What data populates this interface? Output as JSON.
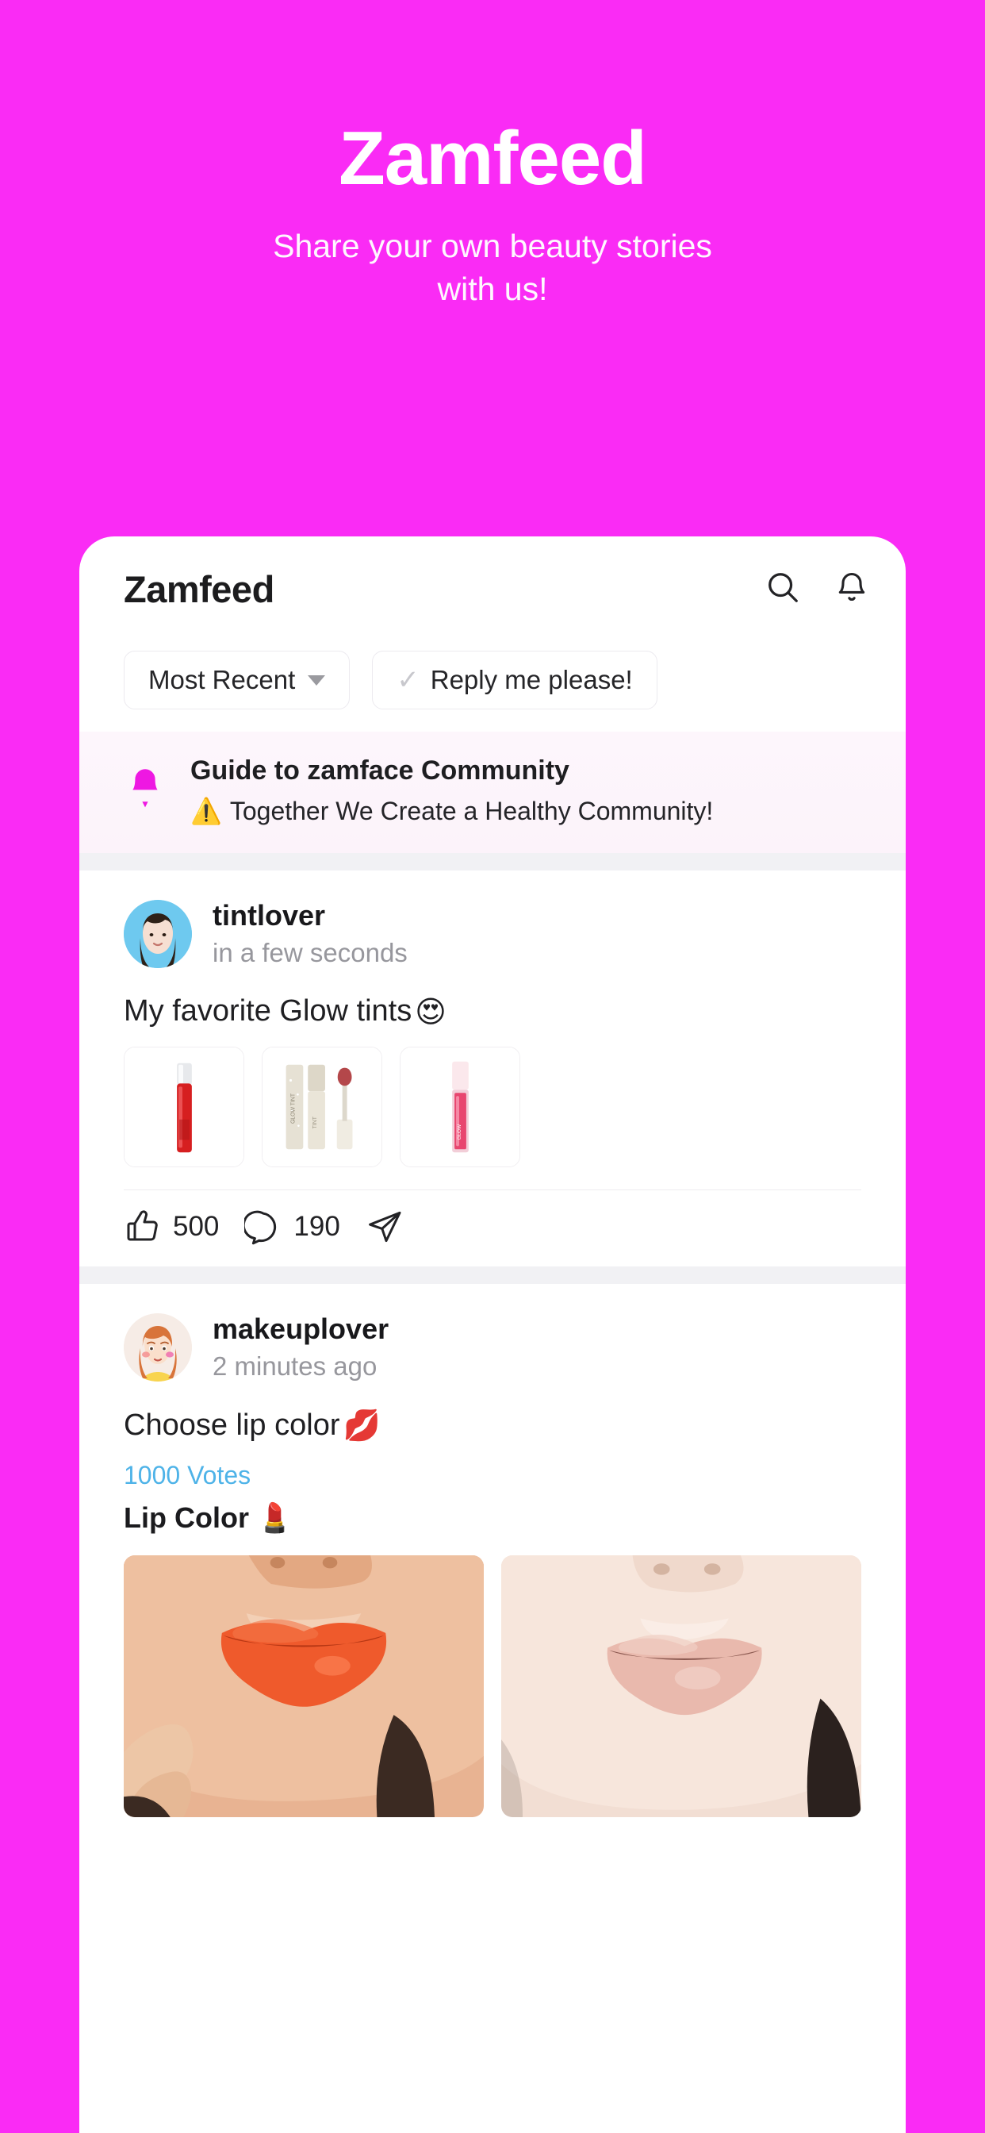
{
  "hero": {
    "title": "Zamfeed",
    "subtitle": "Share your own beauty stories with us!",
    "background_color": "#fa2bf5",
    "text_color": "#ffffff"
  },
  "app": {
    "header": {
      "title": "Zamfeed",
      "search_icon": "search-icon",
      "notification_icon": "bell-icon"
    },
    "filters": [
      {
        "label": "Most Recent",
        "icon": "chevron-down-icon",
        "type": "dropdown"
      },
      {
        "label": "Reply me please!",
        "icon": "check-icon",
        "type": "toggle"
      }
    ],
    "notice": {
      "icon": "bell-icon",
      "icon_color": "#ee18e2",
      "title": "Guide to zamface Community",
      "subtitle_emoji": "⚠️",
      "subtitle": "Together We Create a Healthy Community!"
    },
    "posts": [
      {
        "username": "tintlover",
        "timestamp": "in a few seconds",
        "avatar_bg": "#6ec9ef",
        "text": "My favorite Glow tints",
        "text_emoji": "😍",
        "images": [
          {
            "name": "red-lip-tint-tube"
          },
          {
            "name": "beige-lip-tint-set"
          },
          {
            "name": "pink-lip-tint-tube"
          }
        ],
        "actions": {
          "like_icon": "thumbs-up-icon",
          "like_count": "500",
          "comment_icon": "comment-icon",
          "comment_count": "190",
          "share_icon": "send-icon"
        }
      },
      {
        "username": "makeuplover",
        "timestamp": "2 minutes ago",
        "avatar_bg": "#f6ece6",
        "text": "Choose lip color",
        "text_emoji": "💋",
        "poll": {
          "votes_label": "1000 Votes",
          "votes_color": "#4eb3e8",
          "question": "Lip Color",
          "question_emoji": "💄",
          "options": [
            {
              "name": "orange-coral-lips-photo"
            },
            {
              "name": "natural-nude-lips-photo"
            }
          ]
        }
      }
    ]
  }
}
